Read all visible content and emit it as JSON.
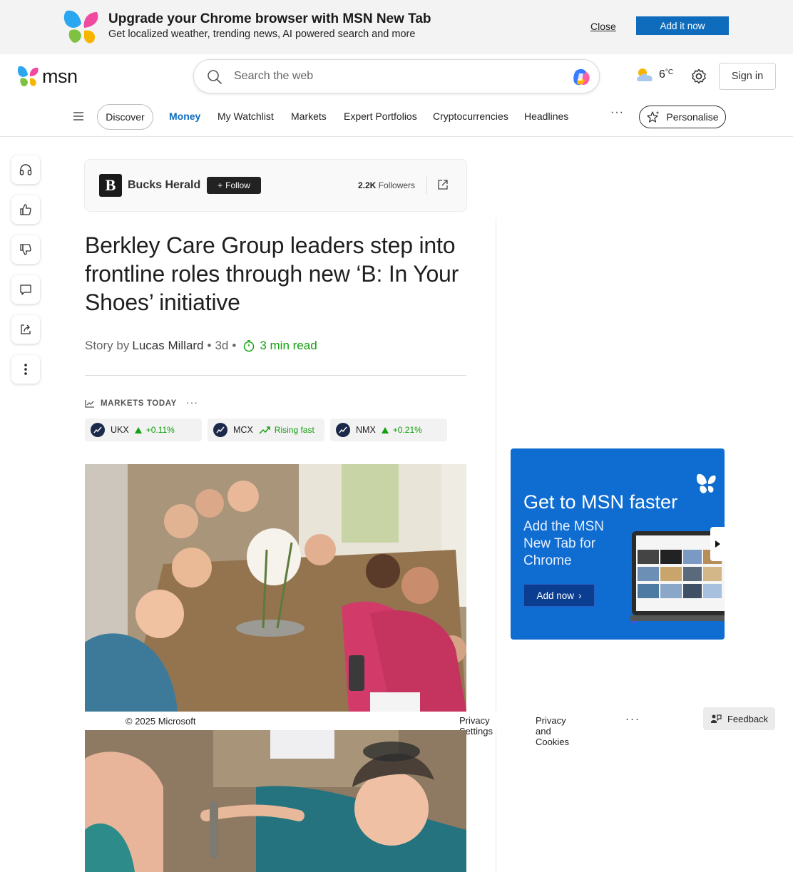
{
  "promo": {
    "title": "Upgrade your Chrome browser with MSN New Tab",
    "subtitle": "Get localized weather, trending news, AI powered search and more",
    "close_label": "Close",
    "add_label": "Add it now"
  },
  "header": {
    "logo_text": "msn",
    "search_placeholder": "Search the web",
    "weather": {
      "temp": "6",
      "unit": "°C",
      "icon": "partly-cloudy-icon"
    },
    "signin_label": "Sign in"
  },
  "nav": {
    "items": [
      {
        "label": "Discover"
      },
      {
        "label": "Money",
        "active": true
      },
      {
        "label": "My Watchlist"
      },
      {
        "label": "Markets"
      },
      {
        "label": "Expert Portfolios"
      },
      {
        "label": "Cryptocurrencies"
      },
      {
        "label": "Headlines"
      }
    ],
    "more_label": "···",
    "personalise_label": "Personalise"
  },
  "rail": {
    "items": [
      "headphones-icon",
      "thumbs-up-icon",
      "thumbs-down-icon",
      "comment-icon",
      "share-icon",
      "more-vertical-icon"
    ]
  },
  "publisher": {
    "logo_letter": "B",
    "name": "Bucks Herald",
    "follow_label": "Follow",
    "followers_count": "2.2K",
    "followers_label": "Followers"
  },
  "article": {
    "headline": "Berkley Care Group leaders step into frontline roles through new ‘B: In Your Shoes’ initiative",
    "story_by": "Story by",
    "author": "Lucas Millard",
    "age": "3d",
    "read_time": "3 min read"
  },
  "markets": {
    "label": "MARKETS TODAY",
    "more_label": "···",
    "tickers": [
      {
        "symbol": "UKX",
        "change": "+0.11%",
        "trend": "up"
      },
      {
        "symbol": "MCX",
        "change": "Rising fast",
        "trend": "rising"
      },
      {
        "symbol": "NMX",
        "change": "+0.21%",
        "trend": "up"
      }
    ]
  },
  "footer": {
    "copyright": "© 2025 Microsoft",
    "privacy_settings": "Privacy Settings",
    "privacy_cookies": "Privacy and Cookies",
    "more_label": "···",
    "feedback_label": "Feedback"
  },
  "ad": {
    "title": "Get to MSN faster",
    "subtitle": "Add the MSN New Tab for Chrome",
    "button_label": "Add now"
  },
  "colors": {
    "accent": "#0f6cbd",
    "positive": "#13a10e",
    "ad_background": "#0f6cd0"
  }
}
